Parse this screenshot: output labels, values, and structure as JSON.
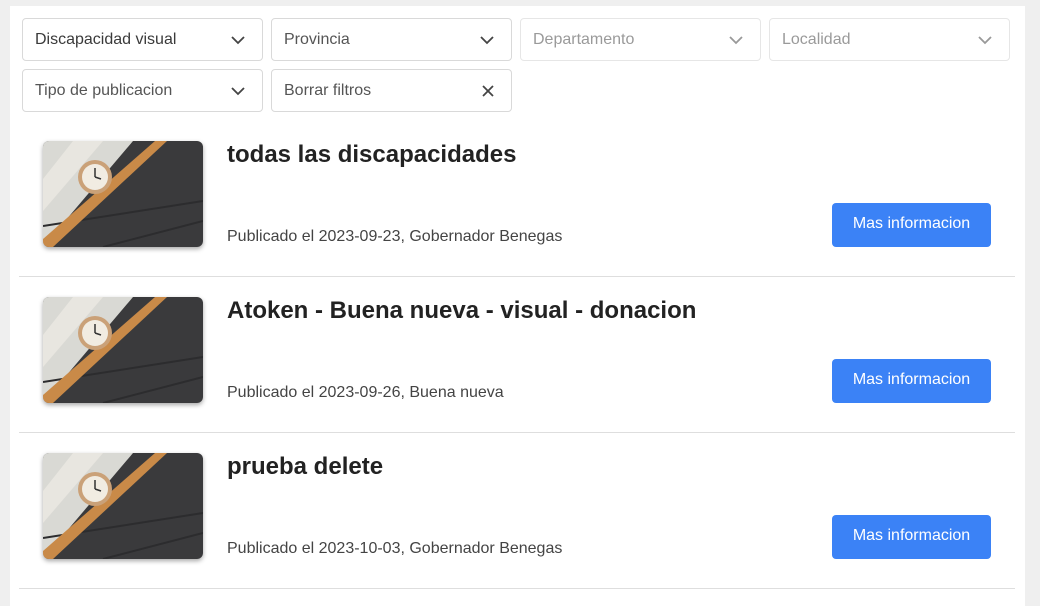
{
  "filters": {
    "discapacidad": "Discapacidad visual",
    "provincia": "Provincia",
    "departamento": "Departamento",
    "localidad": "Localidad",
    "tipo": "Tipo de publicacion",
    "borrar": "Borrar filtros"
  },
  "items": [
    {
      "title": "todas las discapacidades",
      "meta": "Publicado el 2023-09-23, Gobernador Benegas",
      "button": "Mas informacion"
    },
    {
      "title": "Atoken - Buena nueva - visual - donacion",
      "meta": "Publicado el 2023-09-26, Buena nueva",
      "button": "Mas informacion"
    },
    {
      "title": "prueba delete",
      "meta": "Publicado el 2023-10-03, Gobernador Benegas",
      "button": "Mas informacion"
    }
  ]
}
